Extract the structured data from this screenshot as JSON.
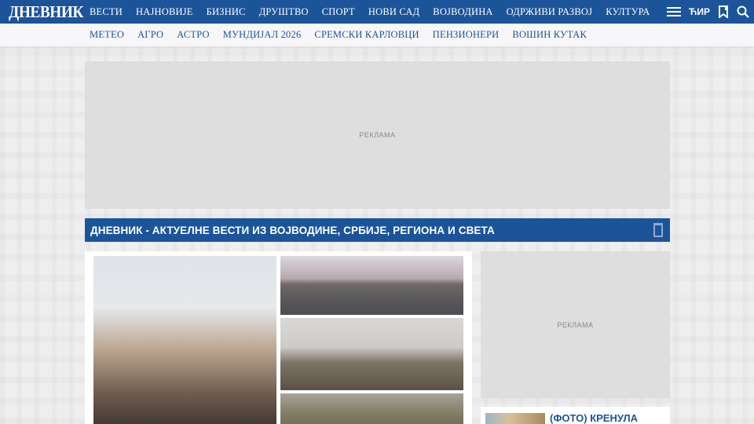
{
  "header": {
    "logo": "ДНЕВНИК",
    "nav": [
      "ВЕСТИ",
      "НАЈНОВИЈЕ",
      "БИЗНИС",
      "ДРУШТВО",
      "СПОРТ",
      "НОВИ САД",
      "ВОЈВОДИНА",
      "ОДРЖИВИ РАЗВОЈ",
      "КУЛТУРА"
    ],
    "script_toggle": "ЋИР",
    "icons": [
      "menu-icon",
      "bookmark-icon",
      "search-icon"
    ]
  },
  "subnav": [
    "МЕТЕО",
    "АГРО",
    "АСТРО",
    "МУНДИЈАЛ 2026",
    "СРЕМСКИ КАРЛОВЦИ",
    "ПЕНЗИОНЕРИ",
    "ВОШИН КУТАК"
  ],
  "ads": {
    "top_label": "РЕКЛАМА",
    "side_label": "РЕКЛАМА"
  },
  "section": {
    "title": "ДНЕВНИК - АКТУЕЛНЕ ВЕСТИ ИЗ ВОЈВОДИНЕ, СРБИЈЕ, РЕГИОНА И СВЕТА"
  },
  "side_news": {
    "title": "(ФОТО) КРЕНУЛА"
  },
  "colors": {
    "brand_blue": "#1b5499",
    "background": "#eeeeee"
  }
}
